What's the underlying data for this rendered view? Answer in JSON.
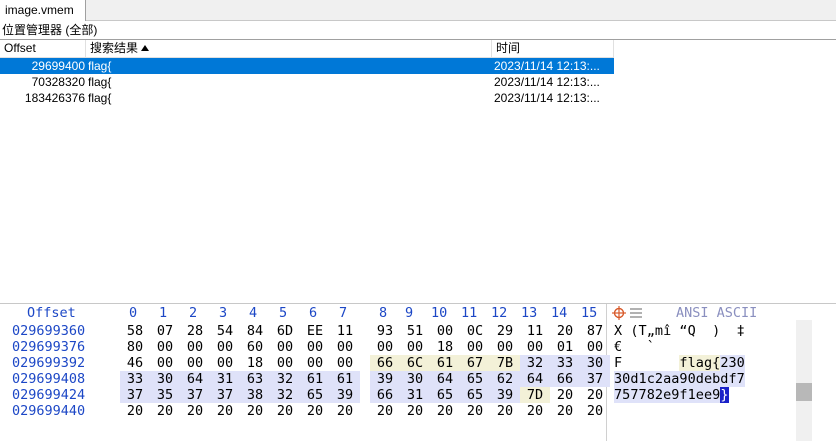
{
  "tab": {
    "label": "image.vmem"
  },
  "panel_title": "位置管理器 (全部)",
  "table": {
    "headers": {
      "offset": "Offset",
      "result": "搜索结果",
      "time": "时间"
    },
    "rows": [
      {
        "offset": "29699400",
        "result": "flag{",
        "time": "2023/11/14  12:13:...",
        "selected": true
      },
      {
        "offset": "70328320",
        "result": "flag{",
        "time": "2023/11/14  12:13:..."
      },
      {
        "offset": "183426376",
        "result": "flag{",
        "time": "2023/11/14  12:13:..."
      }
    ]
  },
  "hex": {
    "header_offset": "Offset",
    "columns": [
      "0",
      "1",
      "2",
      "3",
      "4",
      "5",
      "6",
      "7",
      "8",
      "9",
      "10",
      "11",
      "12",
      "13",
      "14",
      "15"
    ],
    "ascii_header": "ANSI ASCII",
    "rows": [
      {
        "offset": "029699360",
        "bytes": [
          "58",
          "07",
          "28",
          "54",
          "84",
          "6D",
          "EE",
          "11",
          "93",
          "51",
          "00",
          "0C",
          "29",
          "11",
          "20",
          "87"
        ],
        "ascii": "X (T„mî “Q  )  ‡"
      },
      {
        "offset": "029699376",
        "bytes": [
          "80",
          "00",
          "00",
          "00",
          "60",
          "00",
          "00",
          "00",
          "00",
          "00",
          "18",
          "00",
          "00",
          "00",
          "01",
          "00"
        ],
        "ascii": "€   `           "
      },
      {
        "offset": "029699392",
        "bytes": [
          "46",
          "00",
          "00",
          "00",
          "18",
          "00",
          "00",
          "00",
          "66",
          "6C",
          "61",
          "67",
          "7B",
          "32",
          "33",
          "30"
        ],
        "ascii_plain": "F       ",
        "ascii_hl": "flag{230"
      },
      {
        "offset": "029699408",
        "bytes": [
          "33",
          "30",
          "64",
          "31",
          "63",
          "32",
          "61",
          "61",
          "39",
          "30",
          "64",
          "65",
          "62",
          "64",
          "66",
          "37"
        ],
        "ascii_hl": "30d1c2aa90debdf7"
      },
      {
        "offset": "029699424",
        "bytes": [
          "37",
          "35",
          "37",
          "37",
          "38",
          "32",
          "65",
          "39",
          "66",
          "31",
          "65",
          "65",
          "39",
          "7D",
          "20",
          "20"
        ],
        "ascii_hl": "757782e9f1ee9",
        "ascii_cur": "}"
      },
      {
        "offset": "029699440",
        "bytes": [
          "20",
          "20",
          "20",
          "20",
          "20",
          "20",
          "20",
          "20",
          "20",
          "20",
          "20",
          "20",
          "20",
          "20",
          "20",
          "20"
        ],
        "ascii": ""
      }
    ]
  }
}
